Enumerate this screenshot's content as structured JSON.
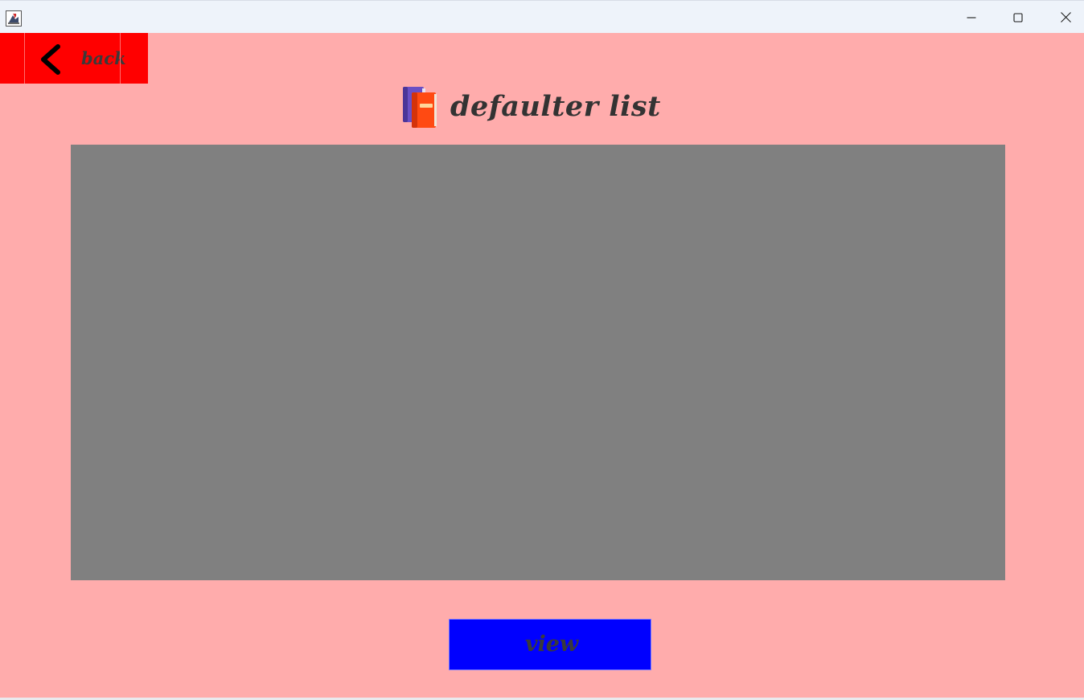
{
  "window": {
    "icon": "java-app-icon",
    "controls": {
      "minimize": "minimize-icon",
      "maximize": "maximize-icon",
      "close": "close-icon"
    }
  },
  "toolbar": {
    "back_label": "back",
    "back_icon": "chevron-left-icon"
  },
  "header": {
    "title": "defaulter list",
    "icon": "books-icon"
  },
  "actions": {
    "view_label": "view"
  },
  "colors": {
    "background": "#ffacac",
    "back_button": "#ff0000",
    "view_button": "#0000ff",
    "table_panel": "#808080",
    "text": "#333333"
  }
}
